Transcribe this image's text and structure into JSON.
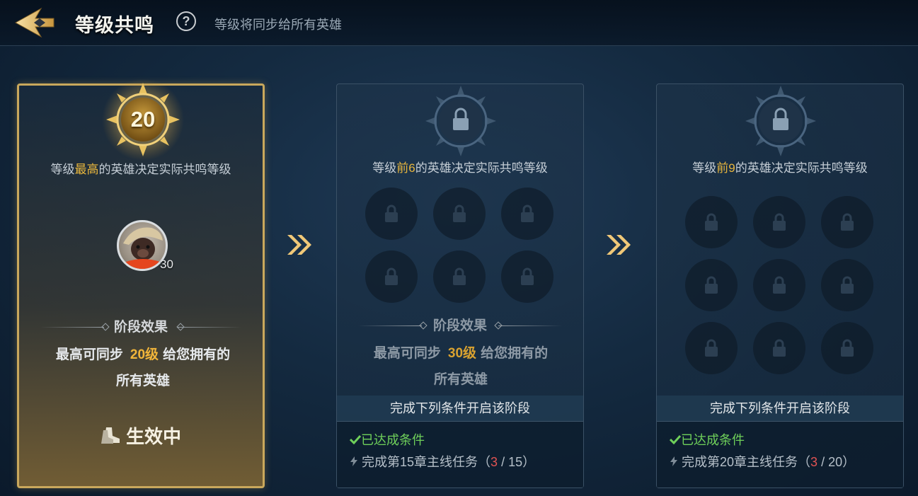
{
  "header": {
    "title": "等级共鸣",
    "help_icon": "?",
    "subtitle": "等级将同步给所有英雄"
  },
  "colors": {
    "accent_gold": "#e8b63d",
    "ok_green": "#6fd05a",
    "progress_red": "#e05353"
  },
  "stages": [
    {
      "state": "active",
      "resonance_level": "20",
      "rule_prefix": "等级",
      "rule_highlight": "最高",
      "rule_suffix": "的英雄决定实际共鸣等级",
      "hero": {
        "level": "30"
      },
      "effect_title": "阶段效果",
      "effect_prefix": "最高可同步",
      "effect_level": "20级",
      "effect_suffix": "给您拥有的",
      "effect_line2": "所有英雄",
      "status": "生效中"
    },
    {
      "state": "locked",
      "rule_prefix": "等级",
      "rule_highlight": "前6",
      "rule_suffix": "的英雄决定实际共鸣等级",
      "slots": 6,
      "effect_title": "阶段效果",
      "effect_prefix": "最高可同步",
      "effect_level": "30级",
      "effect_suffix": "给您拥有的",
      "effect_line2": "所有英雄",
      "condition_header": "完成下列条件开启该阶段",
      "condition_ok": "已达成条件",
      "task_prefix": "完成第15章主线任务（",
      "task_current": "3",
      "task_sep": " / ",
      "task_total": "15",
      "task_suffix": "）"
    },
    {
      "state": "locked",
      "rule_prefix": "等级",
      "rule_highlight": "前9",
      "rule_suffix": "的英雄决定实际共鸣等级",
      "slots": 9,
      "condition_header": "完成下列条件开启该阶段",
      "condition_ok": "已达成条件",
      "task_prefix": "完成第20章主线任务（",
      "task_current": "3",
      "task_sep": " / ",
      "task_total": "20",
      "task_suffix": "）"
    }
  ]
}
